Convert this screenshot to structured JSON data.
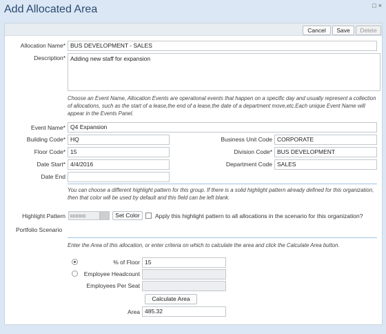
{
  "window": {
    "title": "Add Allocated Area",
    "restore_symbol": "□",
    "close_symbol": "×"
  },
  "toolbar": {
    "cancel": "Cancel",
    "save": "Save",
    "delete": "Delete"
  },
  "form": {
    "allocation_name_label": "Allocation Name*",
    "allocation_name": "BUS DEVELOPMENT - SALES",
    "description_label": "Description*",
    "description": "Adding new staff for expansion",
    "event_note": "Choose an Event Name, Allocation Events are operational events that happen on a specific day and usually represent a collection of allocations, such as the start of a lease,the end of a lease,the date of a department move,etc.Each unique Event Name will appear in the Events Panel.",
    "event_name_label": "Event Name*",
    "event_name": "Q4 Expansion",
    "building_code_label": "Building Code*",
    "building_code": "HQ",
    "floor_code_label": "Floor Code*",
    "floor_code": "15",
    "date_start_label": "Date Start*",
    "date_start": "4/4/2016",
    "date_end_label": "Date End",
    "date_end": "",
    "bu_code_label": "Business Unit Code",
    "bu_code": "CORPORATE",
    "division_code_label": "Division Code*",
    "division_code": "BUS DEVELOPMENT",
    "department_code_label": "Department Code",
    "department_code": "SALES",
    "highlight_note": "You can choose a different highlight pattern for this group. If there is a solid highlight pattern already defined for this organization, then that color will be used by default and this field can be left blank.",
    "highlight_label": "Highlight Pattern",
    "highlight_value": "cccccc",
    "set_color": "Set Color",
    "apply_all_label": "Apply this highlight pattern to all allocations in the scenario for this organization?",
    "portfolio_label": "Portfolio Scenario",
    "area_note": "Enter the Area of this allocation, or enter criteria on which to calculate the area and click the Calculate Area button.",
    "pct_floor_label": "% of Floor",
    "pct_floor": "15",
    "headcount_label": "Employee Headcount",
    "headcount": "",
    "per_seat_label": "Employees Per Seat",
    "per_seat": "",
    "calculate_button": "Calculate Area",
    "area_label": "Area",
    "area": "485.32"
  }
}
